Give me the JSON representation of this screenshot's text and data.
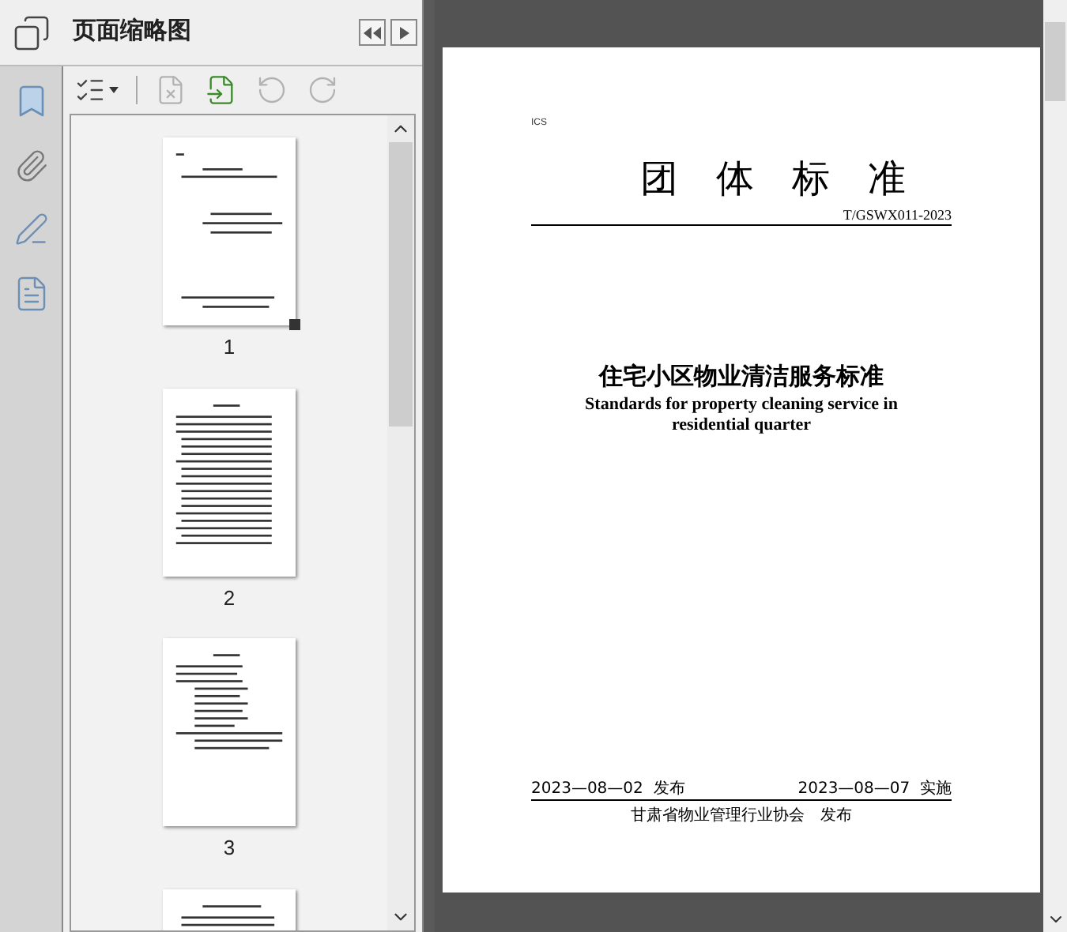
{
  "panel": {
    "title": "页面缩略图"
  },
  "toolbar": [
    {
      "kind": "options",
      "disabled": false
    },
    {
      "kind": "delete",
      "disabled": true
    },
    {
      "kind": "insert",
      "disabled": false
    },
    {
      "kind": "rotate-left",
      "disabled": true
    },
    {
      "kind": "rotate-right",
      "disabled": true
    }
  ],
  "thumbnails": [
    {
      "label": "1",
      "selected": true
    },
    {
      "label": "2",
      "selected": false
    },
    {
      "label": "3",
      "selected": false
    },
    {
      "selected": false
    }
  ],
  "document": {
    "ics": "ICS",
    "heading": "团　体　标　准",
    "code": "T/GSWX011-2023",
    "title_zh": "住宅小区物业清洁服务标准",
    "title_en": "Standards for property cleaning service in residential quarter",
    "issue_date": "2023—08—02  发布",
    "effective_date": "2023—08—07  实施",
    "publisher": "甘肃省物业管理行业协会　发布"
  }
}
